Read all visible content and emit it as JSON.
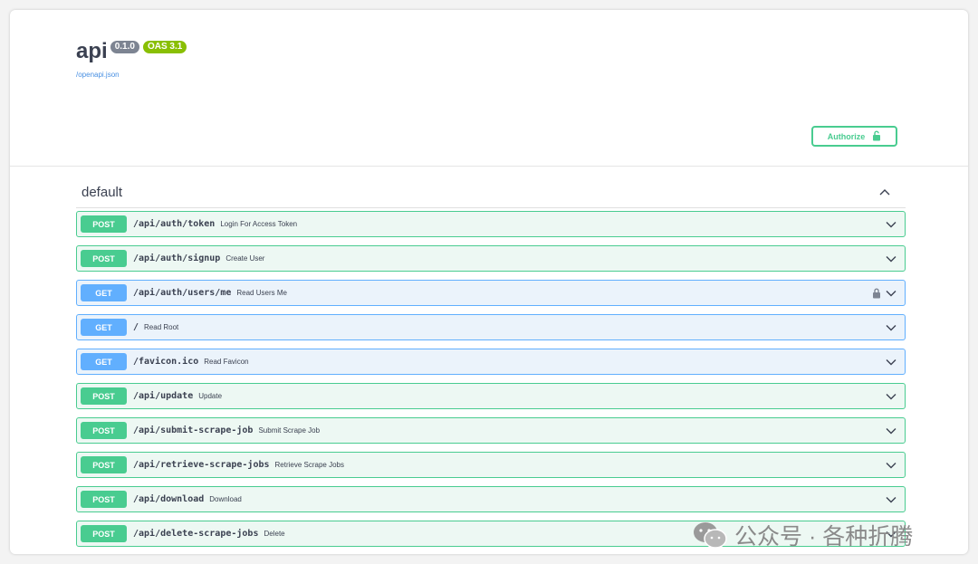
{
  "info": {
    "title": "api",
    "version": "0.1.0",
    "oas_version": "OAS 3.1",
    "spec_url": "/openapi.json"
  },
  "authorize": {
    "label": "Authorize",
    "icon": "unlocked-padlock-icon"
  },
  "section": {
    "title": "default",
    "toggle_icon": "chevron-up-icon"
  },
  "operations": [
    {
      "method": "POST",
      "path": "/api/auth/token",
      "summary": "Login For Access Token",
      "locked": false
    },
    {
      "method": "POST",
      "path": "/api/auth/signup",
      "summary": "Create User",
      "locked": false
    },
    {
      "method": "GET",
      "path": "/api/auth/users/me",
      "summary": "Read Users Me",
      "locked": true
    },
    {
      "method": "GET",
      "path": "/",
      "summary": "Read Root",
      "locked": false
    },
    {
      "method": "GET",
      "path": "/favicon.ico",
      "summary": "Read Favicon",
      "locked": false
    },
    {
      "method": "POST",
      "path": "/api/update",
      "summary": "Update",
      "locked": false
    },
    {
      "method": "POST",
      "path": "/api/submit-scrape-job",
      "summary": "Submit Scrape Job",
      "locked": false
    },
    {
      "method": "POST",
      "path": "/api/retrieve-scrape-jobs",
      "summary": "Retrieve Scrape Jobs",
      "locked": false
    },
    {
      "method": "POST",
      "path": "/api/download",
      "summary": "Download",
      "locked": false
    },
    {
      "method": "POST",
      "path": "/api/delete-scrape-jobs",
      "summary": "Delete",
      "locked": false
    }
  ],
  "watermark": {
    "text": "公众号 · 各种折腾",
    "icon": "wechat-icon"
  },
  "colors": {
    "post": "#49cc90",
    "get": "#61affe",
    "link": "#4990e2",
    "oas_badge": "#89bf04",
    "version_badge": "#7d8492",
    "text": "#3b4151"
  }
}
